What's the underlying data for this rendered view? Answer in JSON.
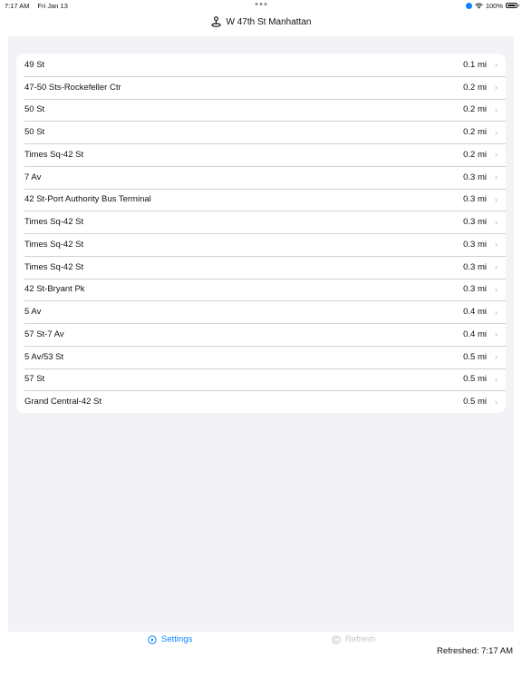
{
  "status_bar": {
    "time": "7:17 AM",
    "date": "Fri Jan 13",
    "battery": "100%"
  },
  "nav": {
    "title": "W 47th St Manhattan",
    "icon": "location-pin-icon"
  },
  "stations": [
    {
      "name": "49 St",
      "distance": "0.1 mi"
    },
    {
      "name": "47-50 Sts-Rockefeller Ctr",
      "distance": "0.2 mi"
    },
    {
      "name": "50 St",
      "distance": "0.2 mi"
    },
    {
      "name": "50 St",
      "distance": "0.2 mi"
    },
    {
      "name": "Times Sq-42 St",
      "distance": "0.2 mi"
    },
    {
      "name": "7 Av",
      "distance": "0.3 mi"
    },
    {
      "name": "42 St-Port Authority Bus Terminal",
      "distance": "0.3 mi"
    },
    {
      "name": "Times Sq-42 St",
      "distance": "0.3 mi"
    },
    {
      "name": "Times Sq-42 St",
      "distance": "0.3 mi"
    },
    {
      "name": "Times Sq-42 St",
      "distance": "0.3 mi"
    },
    {
      "name": "42 St-Bryant Pk",
      "distance": "0.3 mi"
    },
    {
      "name": "5 Av",
      "distance": "0.4 mi"
    },
    {
      "name": "57 St-7 Av",
      "distance": "0.4 mi"
    },
    {
      "name": "5 Av/53 St",
      "distance": "0.5 mi"
    },
    {
      "name": "57 St",
      "distance": "0.5 mi"
    },
    {
      "name": "Grand Central-42 St",
      "distance": "0.5 mi"
    }
  ],
  "toolbar": {
    "settings_label": "Settings",
    "refresh_label": "Refresh",
    "refreshed_text": "Refreshed:  7:17 AM"
  },
  "colors": {
    "accent": "#0a84ff",
    "disabled": "#c7c7cc",
    "background": "#f2f2f7"
  }
}
